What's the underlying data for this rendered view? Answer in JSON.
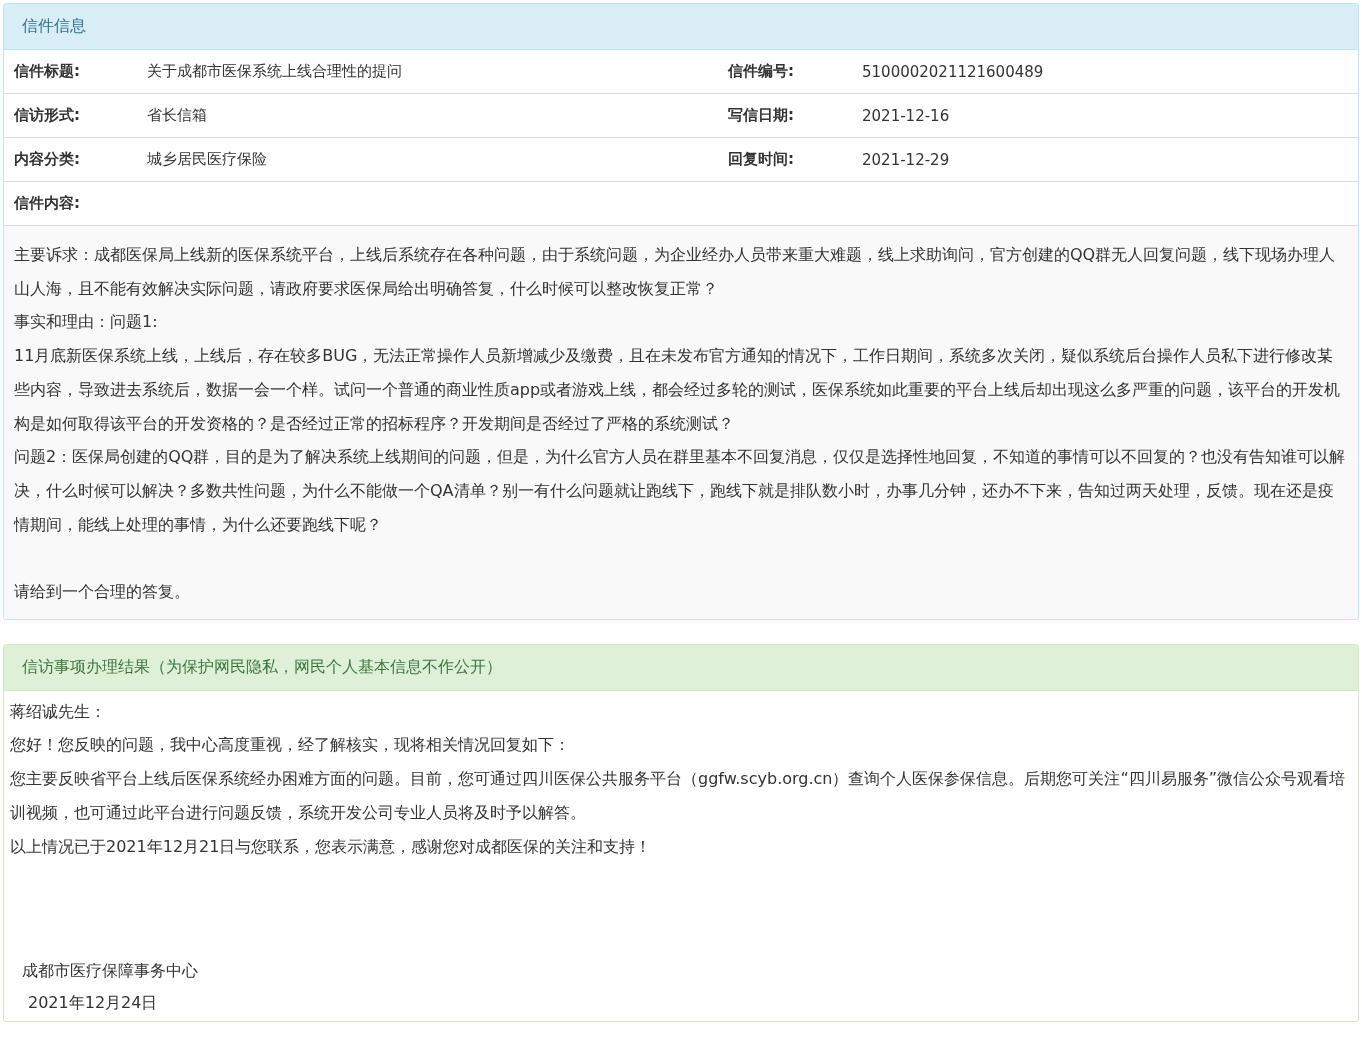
{
  "letter_panel": {
    "title": "信件信息",
    "fields": [
      {
        "label": "信件标题:",
        "value": "关于成都市医保系统上线合理性的提问"
      },
      {
        "label": "信件编号:",
        "value": "5100002021121600489"
      },
      {
        "label": "信访形式:",
        "value": "省长信箱"
      },
      {
        "label": "写信日期:",
        "value": "2021-12-16"
      },
      {
        "label": "内容分类:",
        "value": "城乡居民医疗保险"
      },
      {
        "label": "回复时间:",
        "value": "2021-12-29"
      }
    ],
    "content_label": "信件内容:",
    "content": [
      {
        "text": "主要诉求：成都医保局上线新的医保系统平台，上线后系统存在各种问题，由于系统问题，为企业经办人员带来重大难题，线上求助询问，官方创建的QQ群无人回复问题，线下现场办理人山人海，且不能有效解决实际问题，请政府要求医保局给出明确答复，什么时候可以整改恢复正常？"
      },
      {
        "text": "事实和理由：问题1:"
      },
      {
        "text": "11月底新医保系统上线，上线后，存在较多BUG，无法正常操作人员新增减少及缴费，且在未发布官方通知的情况下，工作日期间，系统多次关闭，疑似系统后台操作人员私下进行修改某些内容，导致进去系统后，数据一会一个样。试问一个普通的商业性质app或者游戏上线，都会经过多轮的测试，医保系统如此重要的平台上线后却出现这么多严重的问题，该平台的开发机构是如何取得该平台的开发资格的？是否经过正常的招标程序？开发期间是否经过了严格的系统测试？"
      },
      {
        "text": "问题2：医保局创建的QQ群，目的是为了解决系统上线期间的问题，但是，为什么官方人员在群里基本不回复消息，仅仅是选择性地回复，不知道的事情可以不回复的？也没有告知谁可以解决，什么时候可以解决？多数共性问题，为什么不能做一个QA清单？别一有什么问题就让跑线下，跑线下就是排队数小时，办事几分钟，还办不下来，告知过两天处理，反馈。现在还是疫情期间，能线上处理的事情，为什么还要跑线下呢？"
      },
      {
        "text": "请给到一个合理的答复。"
      }
    ]
  },
  "reply_panel": {
    "title": "信访事项办理结果（为保护网民隐私，网民个人基本信息不作公开）",
    "paragraphs": [
      "蒋绍诚先生：",
      "您好！您反映的问题，我中心高度重视，经了解核实，现将相关情况回复如下：",
      "您主要反映省平台上线后医保系统经办困难方面的问题。目前，您可通过四川医保公共服务平台（ggfw.scyb.org.cn）查询个人医保参保信息。后期您可关注“四川易服务”微信公众号观看培训视频，也可通过此平台进行问题反馈，系统开发公司专业人员将及时予以解答。",
      "以上情况已于2021年12月21日与您联系，您表示满意，感谢您对成都医保的关注和支持！"
    ],
    "signature": "成都市医疗保障事务中心",
    "date": "2021年12月24日"
  }
}
